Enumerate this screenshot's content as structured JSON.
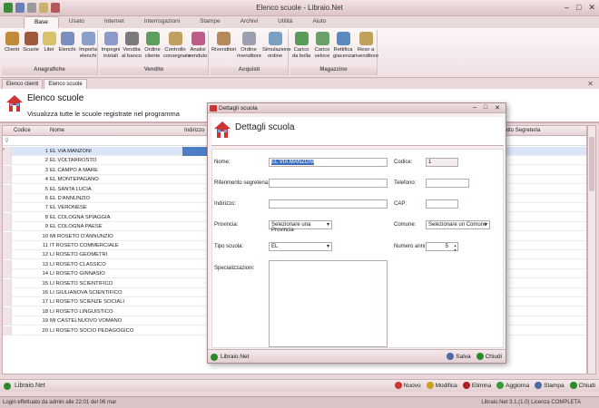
{
  "window": {
    "title": "Elenco scuole - Libraio.Net",
    "min": "–",
    "max": "□",
    "close": "✕"
  },
  "tabs": [
    "Base",
    "Usato",
    "Internet",
    "Interrogazioni",
    "Stampe",
    "Archivi",
    "Utilità",
    "Aiuto"
  ],
  "ribbon": {
    "groups": [
      {
        "title": "Anagrafiche",
        "buttons": [
          "Clienti",
          "Scuole",
          "Libri",
          "Elenchi",
          "Importa elenchi"
        ]
      },
      {
        "title": "Vendite",
        "buttons": [
          "Impegni iniziali",
          "Vendita al banco",
          "Ordine cliente",
          "Controllo consegnato",
          "Analisi venduto"
        ]
      },
      {
        "title": "Acquisti",
        "buttons": [
          "Rivenditori",
          "Ordine rivenditore",
          "Simulazione ordine"
        ]
      },
      {
        "title": "Magazzino",
        "buttons": [
          "Carico da bolla",
          "Carico veloce",
          "Rettifica giacenza",
          "Reso a rivenditore"
        ]
      }
    ]
  },
  "doc_tabs": [
    "Elenco clienti",
    "Elenco scuole"
  ],
  "header": {
    "title": "Elenco scuole",
    "subtitle": "Visualizza tutte le scuole registrate nel programma"
  },
  "grid": {
    "columns": [
      "Codice",
      "Nome",
      "Indirizzo",
      "ntatto Segreteria"
    ],
    "rows": [
      {
        "code": "1",
        "name": "EL VIA MANZONI",
        "c4": ""
      },
      {
        "code": "2",
        "name": "EL VOLTARROSTO",
        "c4": ""
      },
      {
        "code": "3",
        "name": "EL CAMPO A MARE",
        "c4": ""
      },
      {
        "code": "4",
        "name": "EL MONTEPAGANO",
        "c4": ""
      },
      {
        "code": "5",
        "name": "EL SANTA LUCIA",
        "c4": ""
      },
      {
        "code": "6",
        "name": "EL D'ANNUNZIO",
        "c4": ""
      },
      {
        "code": "7",
        "name": "EL VERONESE",
        "c4": ""
      },
      {
        "code": "8",
        "name": "EL COLOGNA SPIAGGIA",
        "c4": ""
      },
      {
        "code": "9",
        "name": "EL COLOGNA PAESE",
        "c4": ""
      },
      {
        "code": "10",
        "name": "MI ROSETO D'ANNUNZIO",
        "c4": ""
      },
      {
        "code": "11",
        "name": "IT ROSETO COMMERCIALE",
        "c4": ""
      },
      {
        "code": "12",
        "name": "LI ROSETO GEOMETRI",
        "c4": ""
      },
      {
        "code": "13",
        "name": "LI ROSETO CLASSICO",
        "c4": ""
      },
      {
        "code": "14",
        "name": "LI ROSETO  GINNASIO",
        "c4": ""
      },
      {
        "code": "15",
        "name": "LI ROSETO SCIENTIFICO",
        "c4": ""
      },
      {
        "code": "16",
        "name": "LI GIULIANOVA SCIENTIFICO",
        "c4": ""
      },
      {
        "code": "17",
        "name": "LI ROSETO SCIENZE SOCIALI",
        "c4": ""
      },
      {
        "code": "18",
        "name": "LI ROSETO LINGUISTICO",
        "c4": ""
      },
      {
        "code": "19",
        "name": "MI CASTELNUOVO VOMANO",
        "c4": ""
      },
      {
        "code": "20",
        "name": "LI ROSETO SOCIO PEDAGOGICO",
        "c4": "Ll"
      }
    ]
  },
  "bottom": {
    "brand": "Libraio.Net",
    "buttons": [
      "Nuovo",
      "Modifica",
      "Elimina",
      "Aggiorna",
      "Stampa",
      "Chiudi"
    ]
  },
  "status": {
    "left": "Login effettuato da admin alle 22:01 del 06 mar",
    "right": "Libraio.Net 3.1.(1.0) Licenza COMPLETA"
  },
  "dialog": {
    "title": "Dettagli scuola",
    "header": "Dettagli scuola",
    "labels": {
      "nome": "Nome:",
      "codice": "Codice:",
      "rif": "Riferimento segreteria:",
      "telefono": "Telefono:",
      "indirizzo": "Indirizzo:",
      "cap": "CAP:",
      "provincia": "Provincia:",
      "comune": "Comune:",
      "tipo": "Tipo scuola:",
      "numero": "Numero anni:",
      "spec": "Specializzazioni:"
    },
    "values": {
      "nome": "EL VIA MANZONI",
      "codice": "1",
      "provincia": "Selezionare una Provincia",
      "comune": "Selezionare un Comune",
      "tipo": "EL",
      "numero": "5"
    },
    "footer": {
      "brand": "Libraio.Net",
      "save": "Salva",
      "close": "Chiudi"
    }
  }
}
